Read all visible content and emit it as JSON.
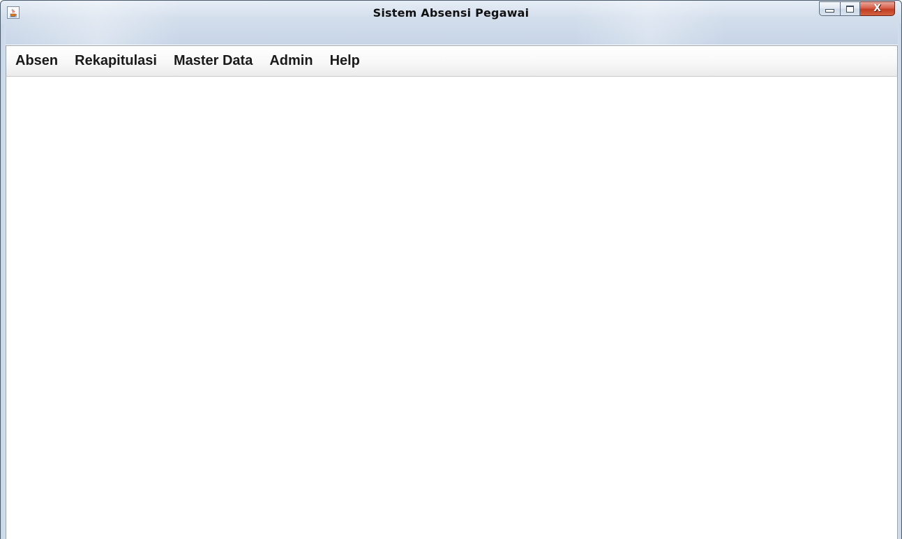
{
  "window": {
    "title": "Sistem Absensi Pegawai",
    "app_icon": "java-coffee-cup-icon",
    "controls": {
      "minimize_icon": "minimize-icon",
      "maximize_icon": "maximize-icon",
      "close_icon": "close-icon",
      "close_glyph": "X"
    }
  },
  "menubar": {
    "items": [
      {
        "label": "Absen"
      },
      {
        "label": "Rekapitulasi"
      },
      {
        "label": "Master Data"
      },
      {
        "label": "Admin"
      },
      {
        "label": "Help"
      }
    ]
  },
  "colors": {
    "titlebar": "#d3deec",
    "close_button": "#c23d23",
    "content_background": "#ffffff"
  }
}
